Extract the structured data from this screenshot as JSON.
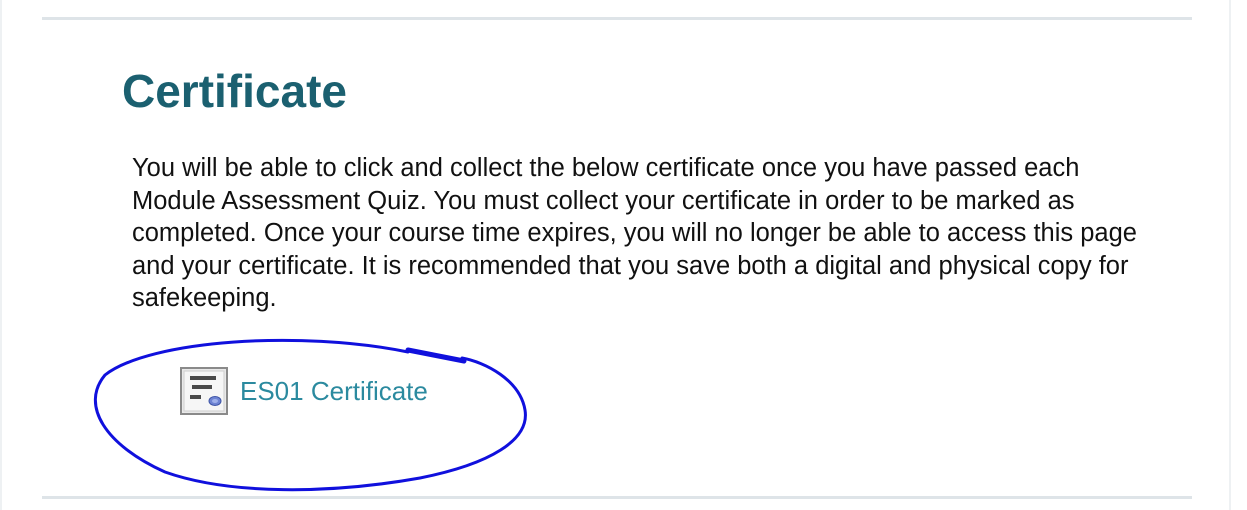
{
  "section": {
    "title": "Certificate",
    "intro": "You will be able to click and collect the below certificate once you have passed each Module Assessment Quiz. You must collect your certificate in order to be marked as completed. Once your course time expires, you will no longer be able to access this page and your certificate. It is recommended that you save both a digital and physical copy for safekeeping."
  },
  "certificate_link": {
    "label": "ES01 Certificate",
    "icon": "certificate-icon"
  },
  "colors": {
    "title": "#1b6070",
    "link": "#2b8a9f",
    "annotation": "#1010dd",
    "rule": "#dee4e8"
  }
}
